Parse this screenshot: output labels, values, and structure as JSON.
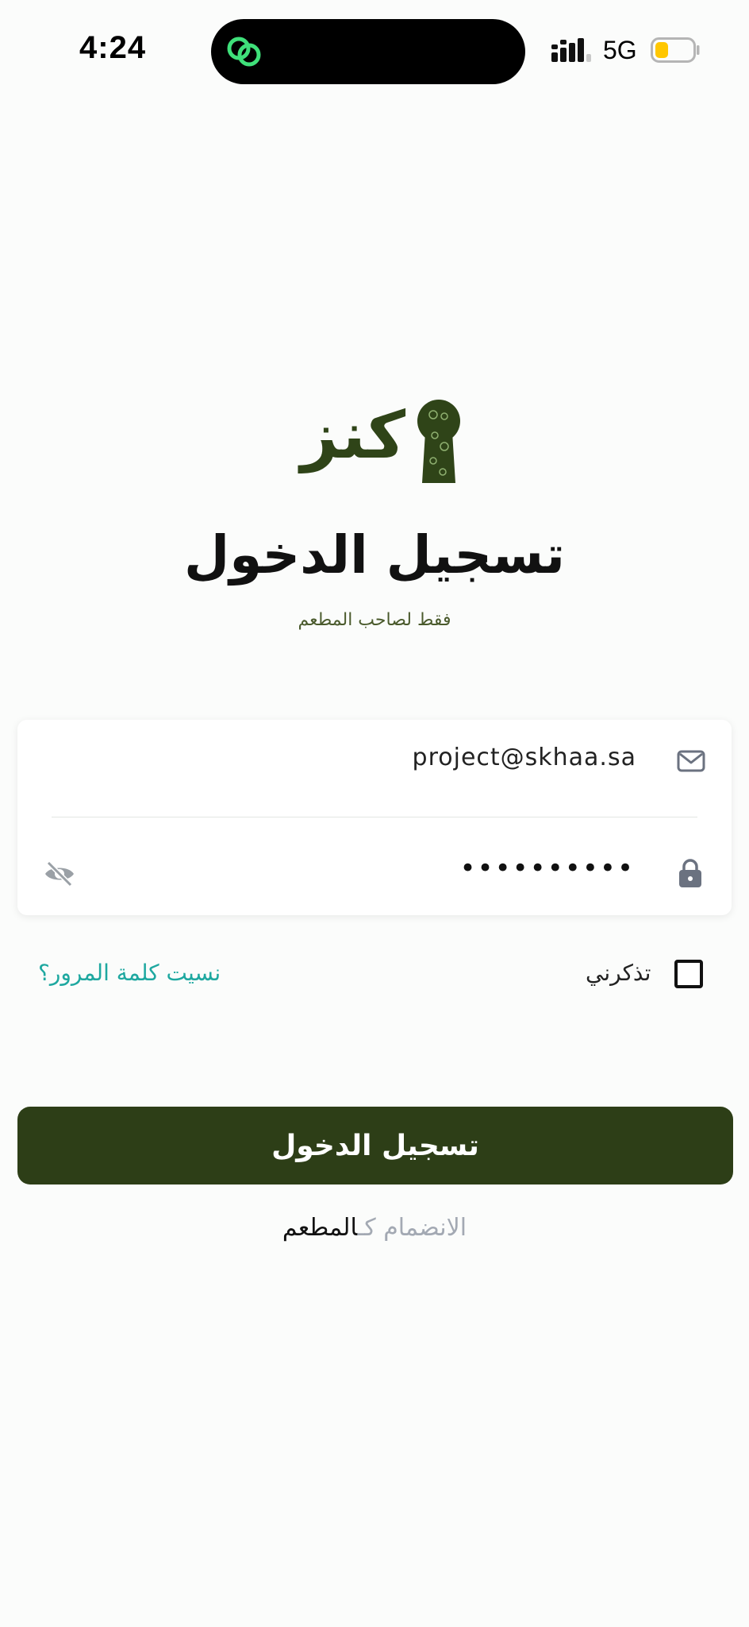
{
  "status_bar": {
    "time": "4:24",
    "network": "5G",
    "battery_level": 0.35,
    "battery_color": "#ffc700"
  },
  "logo": {
    "text": "كنز",
    "icon": "keyhole-logo-icon"
  },
  "header": {
    "title": "تسجيل الدخول",
    "subtitle": "فقط لصاحب المطعم"
  },
  "form": {
    "email": {
      "value": "project@skhaa.sa",
      "icon": "mail-icon"
    },
    "password": {
      "value": "••••••••••",
      "icon": "lock-icon",
      "toggle_icon": "eye-slash-icon"
    }
  },
  "options": {
    "remember_label": "تذكرني",
    "remember_checked": false,
    "forgot_label": "نسيت كلمة المرور؟"
  },
  "login_button": {
    "label": "تسجيل الدخول",
    "color": "#2d3e17"
  },
  "join": {
    "prefix": "الانضمام كـ",
    "role": "المطعم"
  },
  "colors": {
    "accent_teal": "#1ea8a0",
    "brand_green": "#2d3e17",
    "background": "#fbfcfb"
  }
}
